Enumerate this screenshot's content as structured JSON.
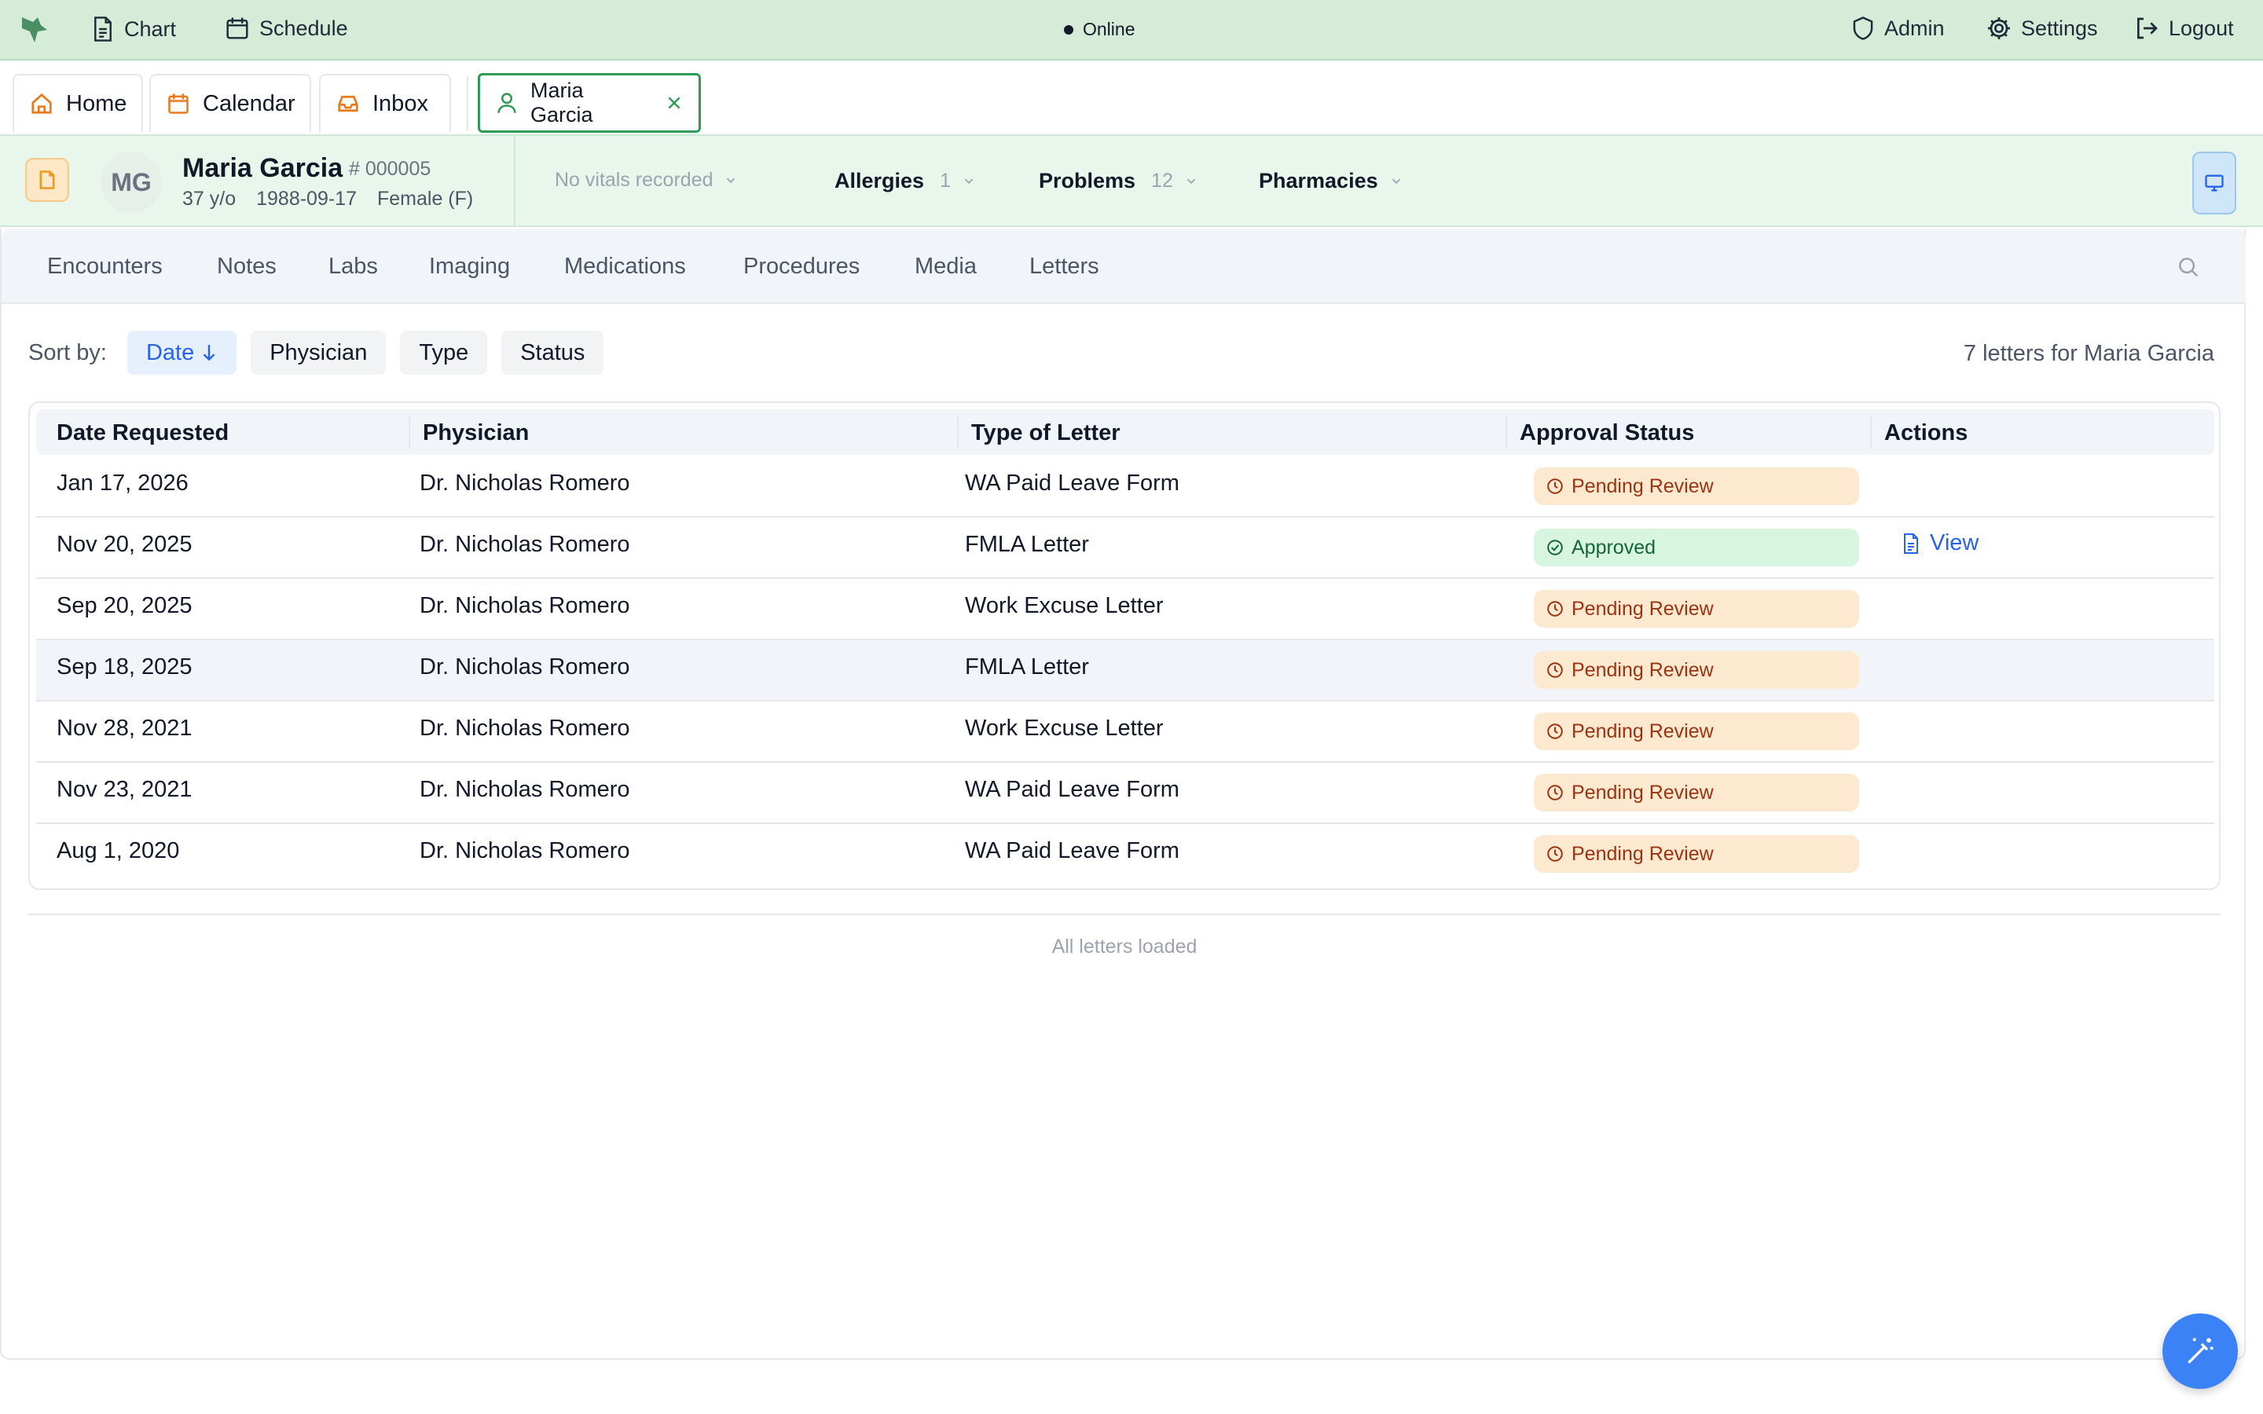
{
  "topbar": {
    "nav": [
      {
        "label": "Chart",
        "icon": "document-icon"
      },
      {
        "label": "Schedule",
        "icon": "calendar-icon"
      }
    ],
    "status": "Online",
    "right": [
      {
        "label": "Admin",
        "icon": "shield-icon"
      },
      {
        "label": "Settings",
        "icon": "gear-icon"
      },
      {
        "label": "Logout",
        "icon": "logout-icon"
      }
    ]
  },
  "tabs": [
    {
      "label": "Home",
      "icon": "home-icon"
    },
    {
      "label": "Calendar",
      "icon": "calendar-icon"
    },
    {
      "label": "Inbox",
      "icon": "inbox-icon"
    },
    {
      "label": "Maria Garcia",
      "icon": "user-icon",
      "active": true
    }
  ],
  "patient": {
    "initials": "MG",
    "name": "Maria Garcia",
    "id": "# 000005",
    "age": "37 y/o",
    "dob": "1988-09-17",
    "sex": "Female (F)",
    "vitals": "No vitals recorded",
    "allergies_label": "Allergies",
    "allergies_count": "1",
    "problems_label": "Problems",
    "problems_count": "12",
    "pharmacies_label": "Pharmacies"
  },
  "subnav": [
    "Encounters",
    "Notes",
    "Labs",
    "Imaging",
    "Medications",
    "Procedures",
    "Media",
    "Letters"
  ],
  "sort": {
    "label": "Sort by:",
    "options": [
      "Date",
      "Physician",
      "Type",
      "Status"
    ],
    "active": "Date",
    "count_text": "7 letters for Maria Garcia"
  },
  "table": {
    "headers": [
      "Date Requested",
      "Physician",
      "Type of Letter",
      "Approval Status",
      "Actions"
    ],
    "rows": [
      {
        "date": "Jan 17, 2026",
        "physician": "Dr. Nicholas Romero",
        "type": "WA Paid Leave Form",
        "status": "Pending Review",
        "action": ""
      },
      {
        "date": "Nov 20, 2025",
        "physician": "Dr. Nicholas Romero",
        "type": "FMLA Letter",
        "status": "Approved",
        "action": "View"
      },
      {
        "date": "Sep 20, 2025",
        "physician": "Dr. Nicholas Romero",
        "type": "Work Excuse Letter",
        "status": "Pending Review",
        "action": ""
      },
      {
        "date": "Sep 18, 2025",
        "physician": "Dr. Nicholas Romero",
        "type": "FMLA Letter",
        "status": "Pending Review",
        "action": ""
      },
      {
        "date": "Nov 28, 2021",
        "physician": "Dr. Nicholas Romero",
        "type": "Work Excuse Letter",
        "status": "Pending Review",
        "action": ""
      },
      {
        "date": "Nov 23, 2021",
        "physician": "Dr. Nicholas Romero",
        "type": "WA Paid Leave Form",
        "status": "Pending Review",
        "action": ""
      },
      {
        "date": "Aug 1, 2020",
        "physician": "Dr. Nicholas Romero",
        "type": "WA Paid Leave Form",
        "status": "Pending Review",
        "action": ""
      }
    ]
  },
  "footer": "All letters loaded",
  "colors": {
    "topbar_bg": "#d5ecd9",
    "patient_bg": "#e9f6ec",
    "accent_green": "#2f9a55",
    "accent_blue": "#2563eb",
    "pending_bg": "#fde9cf",
    "approved_bg": "#d7f5e1"
  }
}
